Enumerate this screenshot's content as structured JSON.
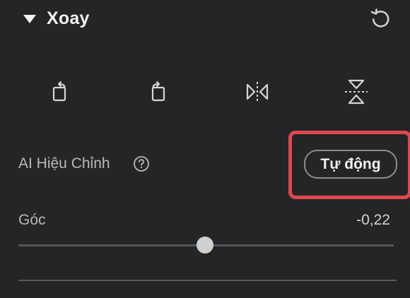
{
  "section": {
    "title": "Xoay"
  },
  "tools": [
    {
      "name": "rotate-left",
      "icon": "rotate-left-icon"
    },
    {
      "name": "rotate-right",
      "icon": "rotate-right-icon"
    },
    {
      "name": "flip-horizontal",
      "icon": "flip-horizontal-icon"
    },
    {
      "name": "flip-vertical",
      "icon": "flip-vertical-icon"
    }
  ],
  "ai_correction": {
    "label": "AI Hiệu Chỉnh",
    "button_label": "Tự động",
    "highlight_color": "#e0484e"
  },
  "angle": {
    "label": "Góc",
    "value": "-0,22",
    "slider_fraction": 0.498
  },
  "colors": {
    "background": "#232527",
    "text": "#e9e9e9",
    "muted_text": "#b9b9b9",
    "accent": "#e0484e"
  }
}
